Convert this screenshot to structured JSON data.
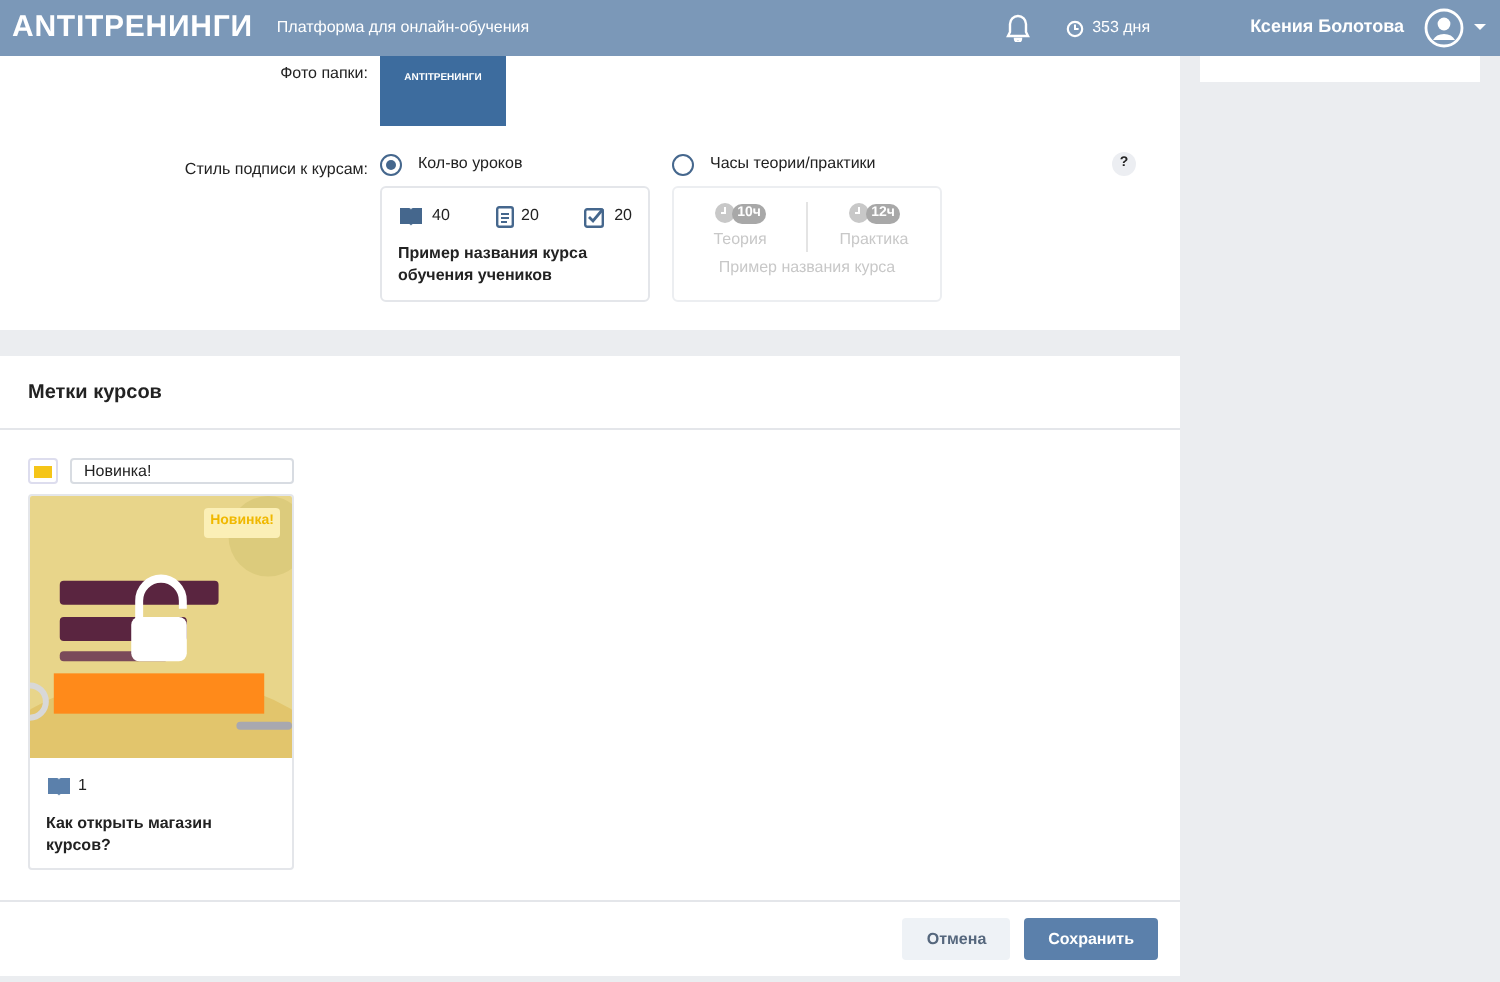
{
  "header": {
    "logo": "ANTITРЕНИНГИ",
    "tagline": "Платформа для онлайн-обучения",
    "days": "353 дня",
    "user": "Ксения Болотова"
  },
  "settings": {
    "photo_label": "Фото папки:",
    "photo_logo": "ANTITРЕНИНГИ",
    "style_label": "Стиль подписи к курсам:",
    "help": "?",
    "options": [
      {
        "label": "Кол-во уроков",
        "selected": true
      },
      {
        "label": "Часы теории/практики",
        "selected": false
      }
    ],
    "lessons_preview": {
      "counts": [
        "40",
        "20",
        "20"
      ],
      "title": "Пример названия курса обучения учеников"
    },
    "hours_preview": {
      "items": [
        {
          "hours": "10ч",
          "label": "Теория"
        },
        {
          "hours": "12ч",
          "label": "Практика"
        }
      ],
      "title": "Пример названия курса"
    }
  },
  "tags": {
    "title": "Метки курсов",
    "color": "#f5c518",
    "tag_value": "Новинка!",
    "course": {
      "kind": "picture",
      "badge": "Новинка!",
      "lessons": "1",
      "title": "Как открыть магазин курсов?"
    }
  },
  "buttons": [
    {
      "label": "Отмена",
      "kind": "secondary"
    },
    {
      "label": "Сохранить",
      "kind": "primary"
    }
  ]
}
